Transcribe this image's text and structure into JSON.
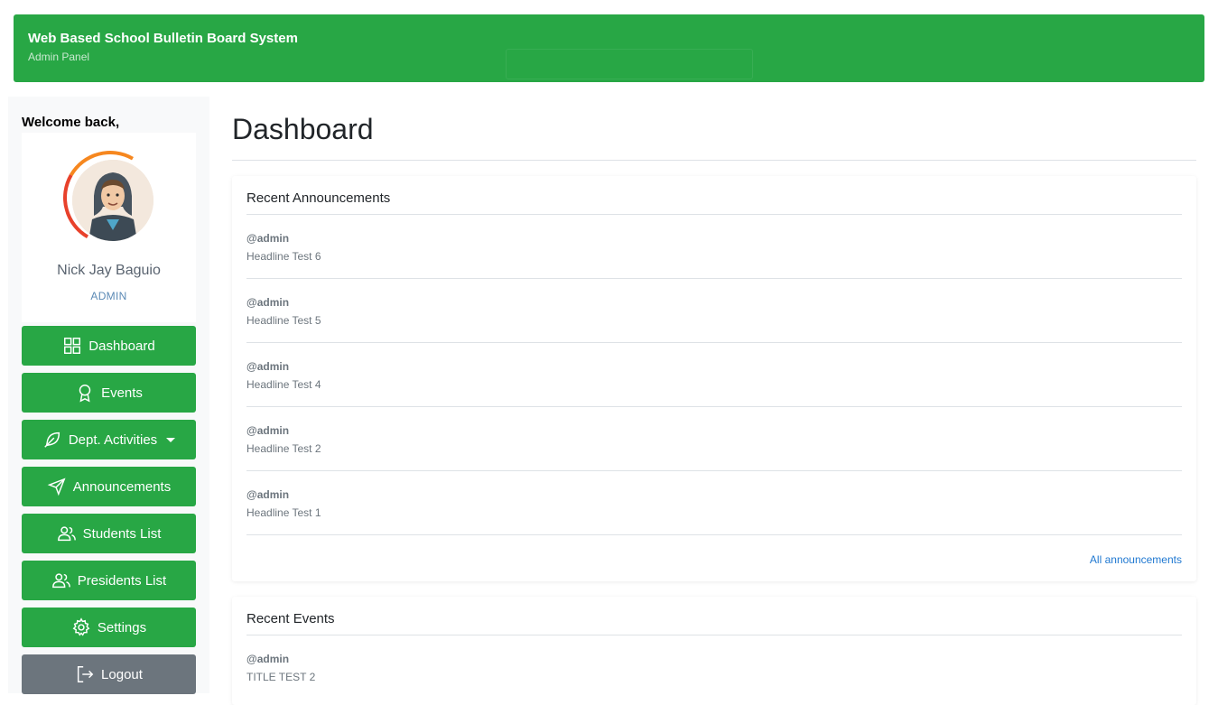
{
  "header": {
    "title": "Web Based School Bulletin Board System",
    "subtitle": "Admin Panel",
    "accent": "#28a745"
  },
  "sidebar": {
    "welcome": "Welcome back,",
    "user": {
      "name": "Nick Jay Baguio",
      "role": "ADMIN"
    },
    "items": [
      {
        "label": "Dashboard",
        "icon": "grid-icon"
      },
      {
        "label": "Events",
        "icon": "award-icon"
      },
      {
        "label": "Dept. Activities",
        "icon": "feather-icon"
      },
      {
        "label": "Announcements",
        "icon": "send-icon"
      },
      {
        "label": "Students List",
        "icon": "users-icon"
      },
      {
        "label": "Presidents List",
        "icon": "users-icon"
      },
      {
        "label": "Settings",
        "icon": "gear-icon"
      },
      {
        "label": "Logout",
        "icon": "logout-icon"
      }
    ]
  },
  "main": {
    "title": "Dashboard",
    "announcements": {
      "heading": "Recent Announcements",
      "items": [
        {
          "author": "@admin",
          "headline": "Headline Test 6"
        },
        {
          "author": "@admin",
          "headline": "Headline Test 5"
        },
        {
          "author": "@admin",
          "headline": "Headline Test 4"
        },
        {
          "author": "@admin",
          "headline": "Headline Test 2"
        },
        {
          "author": "@admin",
          "headline": "Headline Test 1"
        }
      ],
      "link": "All announcements"
    },
    "events": {
      "heading": "Recent Events",
      "items": [
        {
          "author": "@admin",
          "headline": "TITLE TEST 2"
        }
      ]
    }
  }
}
